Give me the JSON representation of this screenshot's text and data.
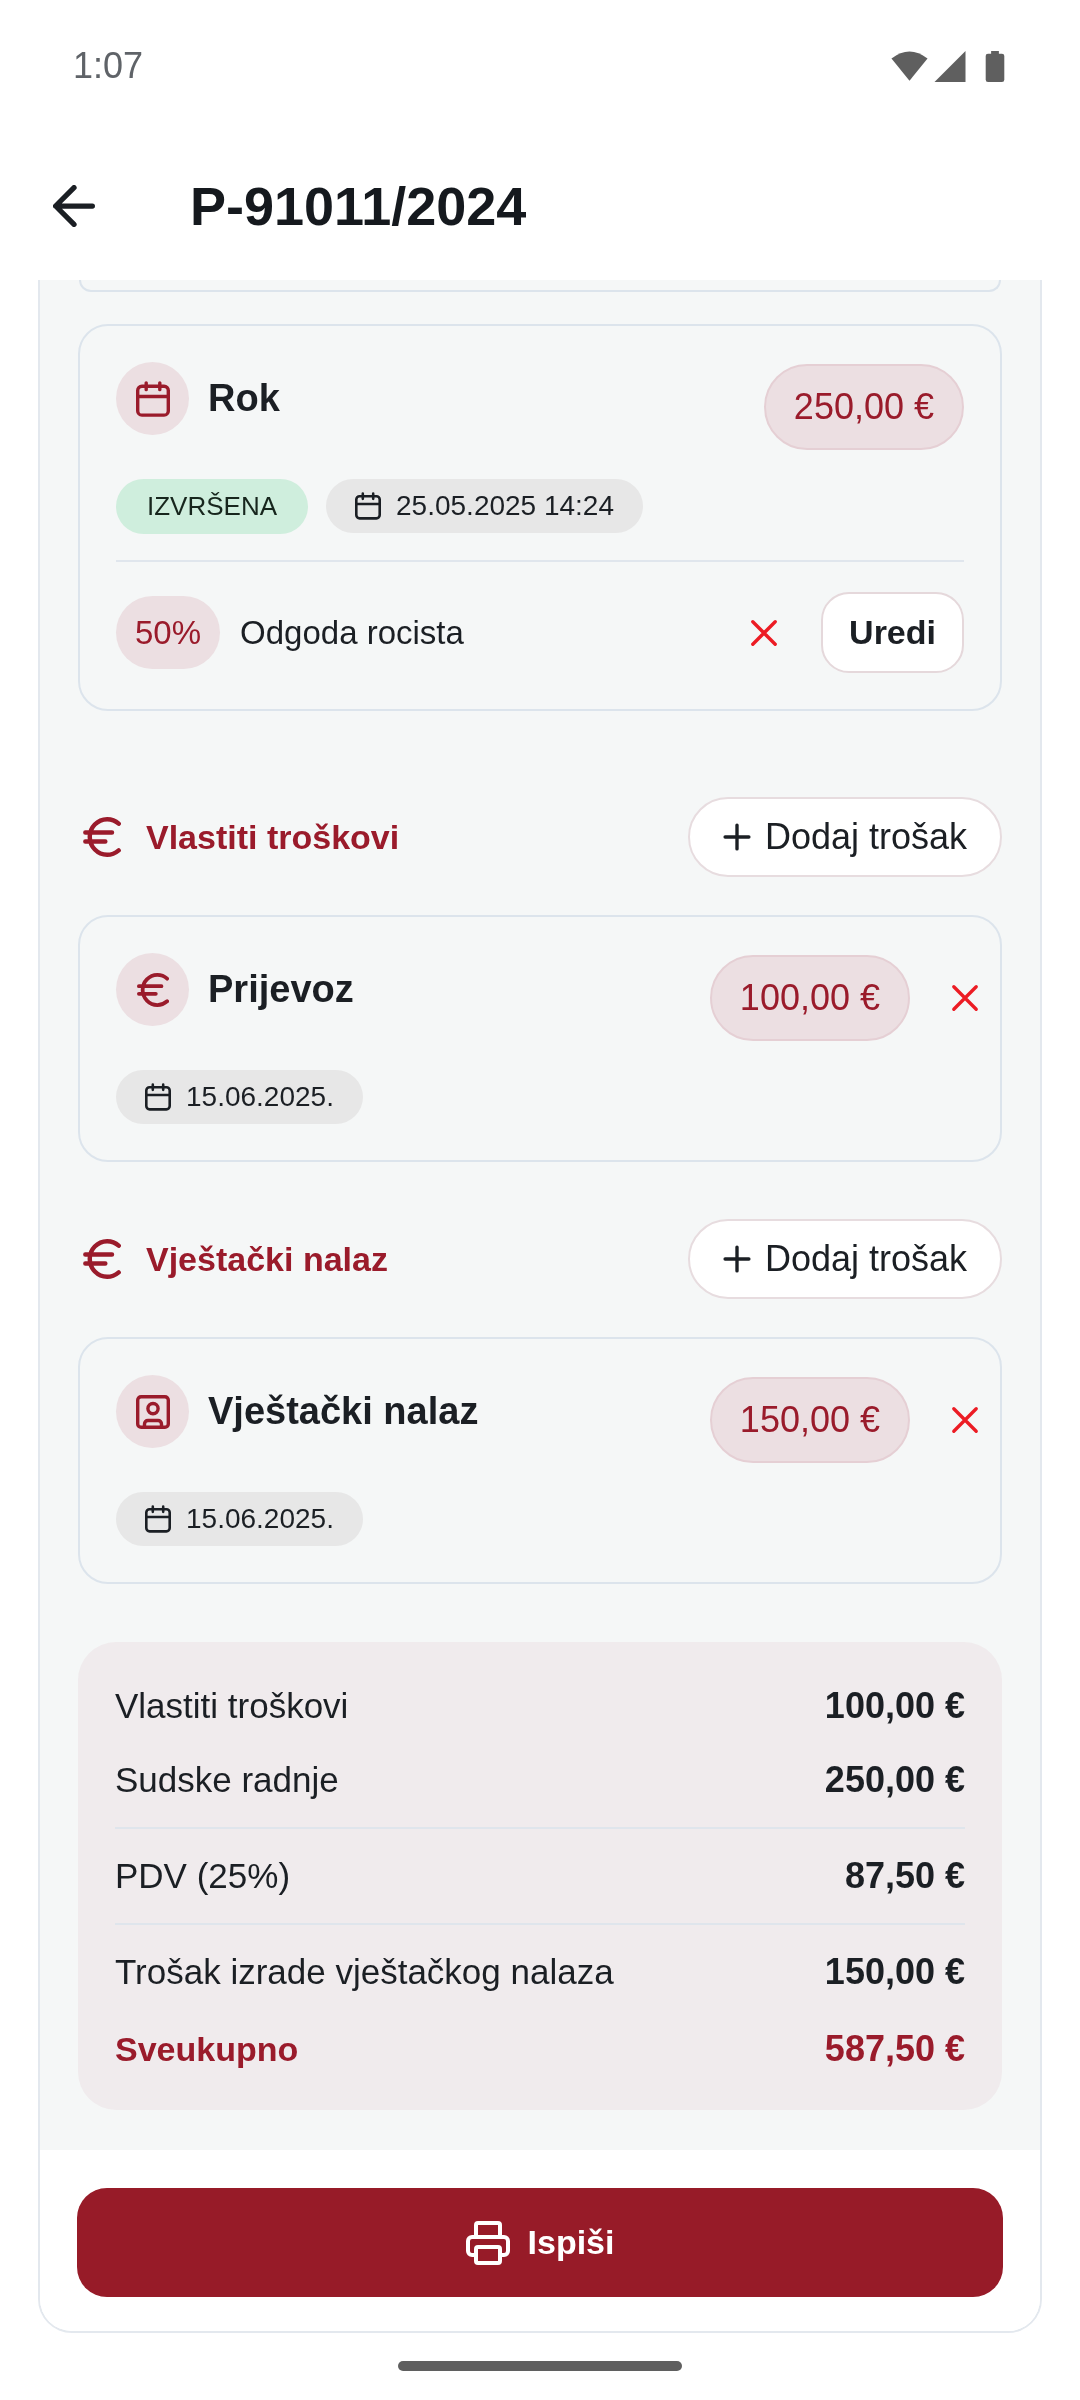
{
  "status_bar": {
    "time": "1:07"
  },
  "header": {
    "title": "P-91011/2024"
  },
  "court_actions": [
    {
      "title": "Rok",
      "amount": "250,00 €",
      "status": "IZVRŠENA",
      "datetime": "25.05.2025 14:24",
      "modifiers": [
        {
          "percent": "50%",
          "label": "Odgoda rocista",
          "edit_button": "Uredi"
        }
      ]
    }
  ],
  "expense_sections": [
    {
      "kind": "own",
      "title": "Vlastiti troškovi",
      "add_button": "Dodaj trošak",
      "items": [
        {
          "title": "Prijevoz",
          "amount": "100,00 €",
          "date": "15.06.2025."
        }
      ]
    },
    {
      "kind": "expert",
      "title": "Vještački nalaz",
      "add_button": "Dodaj trošak",
      "items": [
        {
          "title": "Vještački nalaz",
          "amount": "150,00 €",
          "date": "15.06.2025."
        }
      ]
    }
  ],
  "summary": {
    "groups": [
      {
        "rows": [
          {
            "kind": "line",
            "label": "Vlastiti troškovi",
            "value": "100,00 €"
          },
          {
            "kind": "line",
            "label": "Sudske radnje",
            "value": "250,00 €"
          }
        ]
      },
      {
        "rows": [
          {
            "kind": "line",
            "label": "PDV (25%)",
            "value": "87,50 €"
          }
        ]
      },
      {
        "rows": [
          {
            "kind": "line",
            "label": "Trošak izrade vještačkog nalaza",
            "value": "150,00 €"
          },
          {
            "kind": "total",
            "label": "Sveukupno",
            "value": "587,50 €"
          }
        ]
      }
    ]
  },
  "footer": {
    "print_button": "Ispiši"
  }
}
